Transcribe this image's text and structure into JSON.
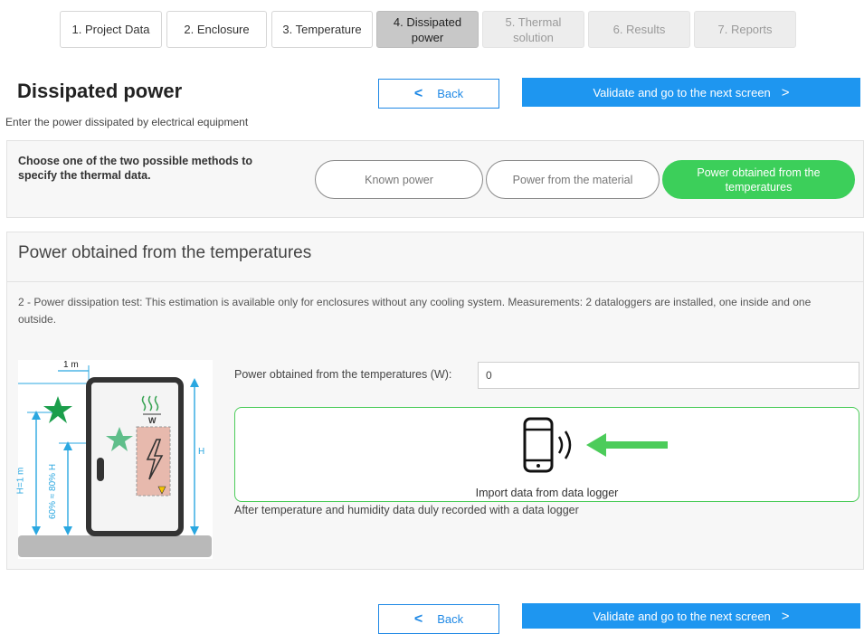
{
  "steps": [
    {
      "label": "1. Project Data",
      "state": "normal"
    },
    {
      "label": "2. Enclosure",
      "state": "normal"
    },
    {
      "label": "3. Temperature",
      "state": "normal"
    },
    {
      "label": "4. Dissipated power",
      "state": "active"
    },
    {
      "label": "5. Thermal solution",
      "state": "disabled"
    },
    {
      "label": "6. Results",
      "state": "disabled"
    },
    {
      "label": "7. Reports",
      "state": "disabled"
    }
  ],
  "header": {
    "title": "Dissipated power",
    "subtitle": "Enter the power dissipated by electrical equipment"
  },
  "nav": {
    "back_label": "Back",
    "next_label": "Validate and go to the next screen"
  },
  "method": {
    "prompt": "Choose one of the two possible methods to specify the thermal data.",
    "options": [
      {
        "label": "Known power",
        "selected": false
      },
      {
        "label": "Power from the material",
        "selected": false
      },
      {
        "label": "Power obtained from the temperatures",
        "selected": true
      }
    ]
  },
  "section": {
    "title": "Power obtained from the temperatures",
    "description": "2 - Power dissipation test: This estimation is available only for enclosures without any cooling system. Measurements: 2 dataloggers are installed, one inside and one outside."
  },
  "diagram": {
    "label_1m": "1 m",
    "label_h1m": "H=1 m",
    "label_pct": "60% ≈ 80% H",
    "label_h": "H",
    "label_watt": "W"
  },
  "power_field": {
    "label": "Power obtained from the temperatures (W):",
    "value": "0"
  },
  "import": {
    "label": "Import data from data logger",
    "note": "After temperature and humidity data duly recorded with a data logger",
    "phone_icon": "smartphone-signal-icon",
    "arrow_icon": "arrow-left-icon"
  },
  "colors": {
    "primary": "#1e96f0",
    "selected": "#3ccf5a",
    "arrow": "#4ccc5a"
  }
}
